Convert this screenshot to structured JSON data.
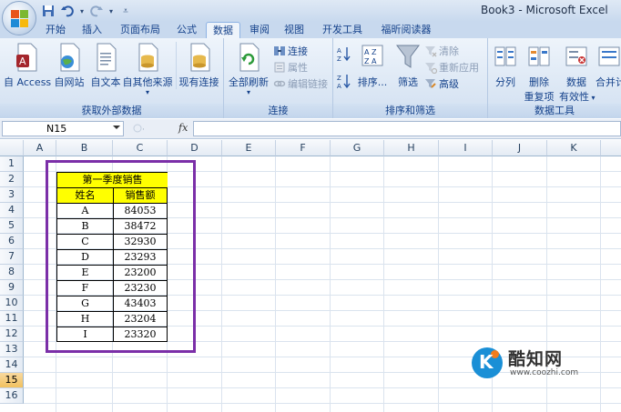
{
  "window_title": "Book3 - Microsoft Excel",
  "quick_access": [
    "save-icon",
    "undo-icon",
    "redo-icon",
    "customize-icon"
  ],
  "tabs": [
    {
      "label": "开始",
      "active": false
    },
    {
      "label": "插入",
      "active": false
    },
    {
      "label": "页面布局",
      "active": false
    },
    {
      "label": "公式",
      "active": false
    },
    {
      "label": "数据",
      "active": true
    },
    {
      "label": "审阅",
      "active": false
    },
    {
      "label": "视图",
      "active": false
    },
    {
      "label": "开发工具",
      "active": false
    },
    {
      "label": "福昕阅读器",
      "active": false
    }
  ],
  "ribbon": {
    "get_external": {
      "label": "获取外部数据",
      "buttons": [
        "自 Access",
        "自网站",
        "自文本",
        "自其他来源",
        "现有连接"
      ]
    },
    "connections": {
      "label": "连接",
      "refresh_all": "全部刷新",
      "connections": "连接",
      "properties": "属性",
      "edit_links": "编辑链接"
    },
    "sort_filter": {
      "label": "排序和筛选",
      "sort": "排序...",
      "filter": "筛选",
      "clear": "清除",
      "reapply": "重新应用",
      "advanced": "高级"
    },
    "data_tools": {
      "label": "数据工具",
      "split": "分列",
      "remove_dup_1": "删除",
      "remove_dup_2": "重复项",
      "validation_1": "数据",
      "validation_2": "有效性",
      "consolidate": "合并计"
    }
  },
  "formula_bar": {
    "name_box": "N15",
    "fx": "fx",
    "formula": ""
  },
  "columns": [
    "A",
    "B",
    "C",
    "D",
    "E",
    "F",
    "G",
    "H",
    "I",
    "J",
    "K"
  ],
  "rows": [
    "1",
    "2",
    "3",
    "4",
    "5",
    "6",
    "7",
    "8",
    "9",
    "10",
    "11",
    "12",
    "13",
    "14",
    "15",
    "16"
  ],
  "selected_row": "15",
  "table": {
    "title": "第一季度销售",
    "headers": [
      "姓名",
      "销售额"
    ],
    "rows": [
      [
        "A",
        "84053"
      ],
      [
        "B",
        "38472"
      ],
      [
        "C",
        "32930"
      ],
      [
        "D",
        "23293"
      ],
      [
        "E",
        "23200"
      ],
      [
        "F",
        "23230"
      ],
      [
        "G",
        "43403"
      ],
      [
        "H",
        "23204"
      ],
      [
        "I",
        "23320"
      ]
    ]
  },
  "colors": {
    "header_fill": "#ffff00",
    "highlight_box": "#7b2fa8",
    "selected_row": "#f1c15f"
  },
  "watermark": {
    "name": "酷知网",
    "url": "www.coozhi.com"
  }
}
